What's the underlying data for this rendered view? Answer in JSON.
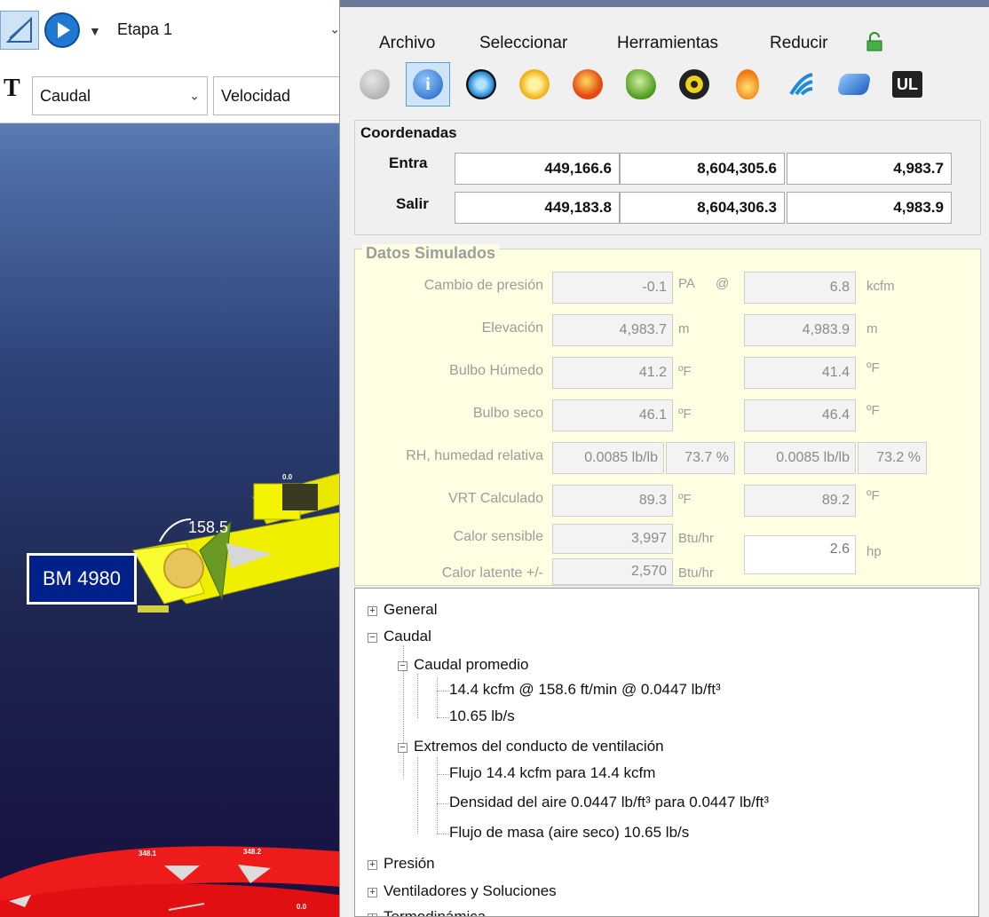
{
  "left_toolbar": {
    "stage_select": "Etapa 1",
    "flow_select": "Caudal",
    "velocity_select": "Velocidad"
  },
  "scene": {
    "node_label": "BM 4980",
    "airway_label": "158.5",
    "labels_small": [
      "0.0",
      "348.1",
      "348.2",
      "0.0"
    ]
  },
  "menu": {
    "file": "Archivo",
    "select": "Seleccionar",
    "tools": "Herramientas",
    "reduce": "Reducir"
  },
  "coordinates": {
    "title": "Coordenadas",
    "entry_label": "Entra",
    "exit_label": "Salir",
    "entry": [
      "449,166.6",
      "8,604,305.6",
      "4,983.7"
    ],
    "exit": [
      "449,183.8",
      "8,604,306.3",
      "4,983.9"
    ]
  },
  "simulated": {
    "title": "Datos Simulados",
    "pressure_change": {
      "label": "Cambio de presión",
      "value": "-0.1",
      "unit": "PA",
      "at": "@",
      "value2": "6.8",
      "unit2": "kcfm"
    },
    "elevation": {
      "label": "Elevación",
      "value": "4,983.7",
      "unit": "m",
      "value2": "4,983.9",
      "unit2": "m"
    },
    "wet_bulb": {
      "label": "Bulbo Húmedo",
      "value": "41.2",
      "unit": "ºF",
      "value2": "41.4",
      "unit2": "ºF"
    },
    "dry_bulb": {
      "label": "Bulbo seco",
      "value": "46.1",
      "unit": "ºF",
      "value2": "46.4",
      "unit2": "ºF"
    },
    "rh": {
      "label": "RH, humedad relativa",
      "value_a": "0.0085 lb/lb",
      "value_b": "73.7 %",
      "value2_a": "0.0085 lb/lb",
      "value2_b": "73.2 %"
    },
    "vrt": {
      "label": "VRT Calculado",
      "value": "89.3",
      "unit": "ºF",
      "value2": "89.2",
      "unit2": "ºF"
    },
    "sensible": {
      "label": "Calor sensible",
      "value": "3,997",
      "unit": "Btu/hr"
    },
    "latent": {
      "label": "Calor latente +/-",
      "value": "2,570",
      "unit": "Btu/hr"
    },
    "power": {
      "value": "2.6",
      "unit": "hp"
    }
  },
  "tree": {
    "general": "General",
    "caudal": "Caudal",
    "caudal_promedio": "Caudal promedio",
    "caudal_line1": "14.4 kcfm  @  158.6 ft/min  @  0.0447 lb/ft³",
    "caudal_line2": "10.65 lb/s",
    "extremos": "Extremos del conducto de ventilación",
    "flujo": "Flujo   14.4 kcfm  para 14.4 kcfm",
    "densidad": "Densidad del aire 0.0447 lb/ft³  para 0.0447 lb/ft³",
    "masa": "Flujo de masa (aire seco)  10.65 lb/s",
    "presion": "Presión",
    "ventiladores": "Ventiladores y Soluciones",
    "termo": "Termodinámica"
  }
}
